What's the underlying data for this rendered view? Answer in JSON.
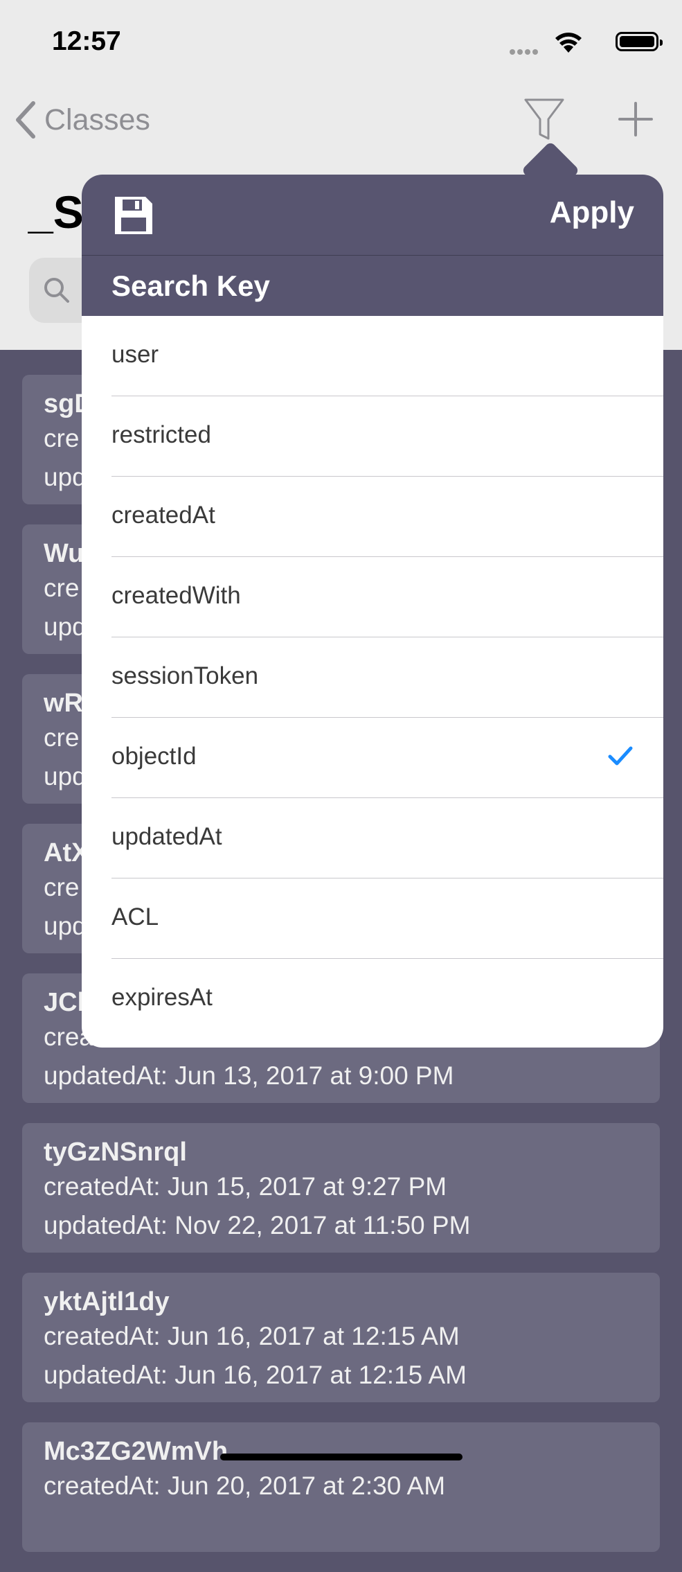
{
  "status_bar": {
    "time": "12:57"
  },
  "nav": {
    "back_label": "Classes",
    "title": "_Session"
  },
  "popover": {
    "apply_label": "Apply",
    "section_header": "Search Key",
    "keys": [
      {
        "label": "user",
        "selected": false
      },
      {
        "label": "restricted",
        "selected": false
      },
      {
        "label": "createdAt",
        "selected": false
      },
      {
        "label": "createdWith",
        "selected": false
      },
      {
        "label": "sessionToken",
        "selected": false
      },
      {
        "label": "objectId",
        "selected": true
      },
      {
        "label": "updatedAt",
        "selected": false
      },
      {
        "label": "ACL",
        "selected": false
      },
      {
        "label": "expiresAt",
        "selected": false
      }
    ]
  },
  "records": [
    {
      "id": "sgD",
      "created": "cre",
      "updated": "upd"
    },
    {
      "id": "Wu",
      "created": "cre",
      "updated": "upd"
    },
    {
      "id": "wR",
      "created": "cre",
      "updated": "upd"
    },
    {
      "id": "AtX",
      "created": "cre",
      "updated": "upd"
    },
    {
      "id": "JCl",
      "created": "crea",
      "updated": "updatedAt: Jun 13, 2017 at 9:00 PM"
    },
    {
      "id": "tyGzNSnrql",
      "created": "createdAt: Jun 15, 2017 at 9:27 PM",
      "updated": "updatedAt: Nov 22, 2017 at 11:50 PM"
    },
    {
      "id": "yktAjtl1dy",
      "created": "createdAt: Jun 16, 2017 at 12:15 AM",
      "updated": "updatedAt: Jun 16, 2017 at 12:15 AM"
    },
    {
      "id": "Mc3ZG2WmVh",
      "created": "createdAt: Jun 20, 2017 at 2:30 AM",
      "updated": ""
    }
  ],
  "colors": {
    "popover_header": "#585570",
    "background": "#57546c",
    "card": "#6c6a80",
    "accent": "#1a8cff"
  }
}
